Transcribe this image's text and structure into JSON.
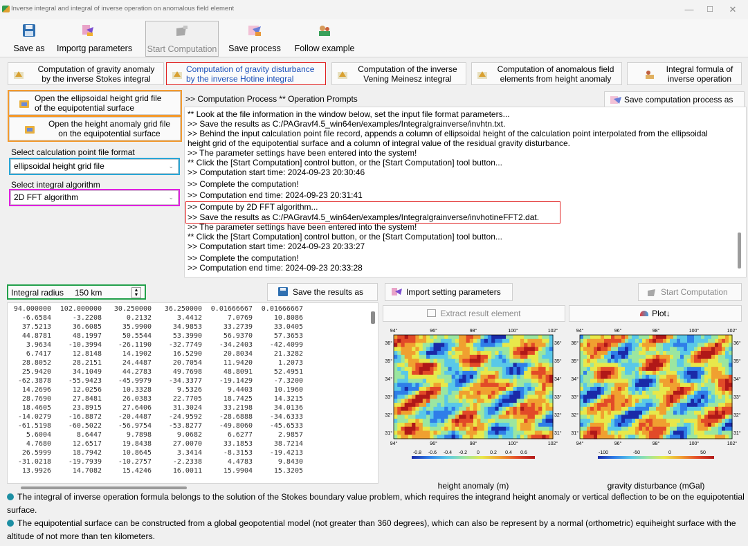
{
  "window": {
    "title": "Inverse integral and integral of inverse operation on anomalous field element"
  },
  "toolbar": {
    "save_as": "Save as",
    "import_params": "Importg parameters",
    "start": "Start Computation",
    "save_process": "Save process",
    "follow": "Follow example"
  },
  "functions": {
    "f1_a": "Computation of gravity anomaly",
    "f1_b": "by the inverse Stokes integral",
    "f2_a": "Computation of gravity disturbance",
    "f2_b": "by the inverse Hotine integral",
    "f3_a": "Computation of the inverse",
    "f3_b": "Vening Meinesz integral",
    "f4_a": "Computation of anomalous field",
    "f4_b": "elements from height anomaly",
    "f5_a": "Integral formula of",
    "f5_b": "inverse operation"
  },
  "left": {
    "open_ell_a": "Open the ellipsoidal height grid file",
    "open_ell_b": "of the equipotential surface",
    "open_ha_a": "Open the height anomaly grid file",
    "open_ha_b": "on the equipotential surface",
    "fmt_label": "Select calculation point file format",
    "fmt_value": "ellipsoidal height grid file",
    "alg_label": "Select integral algorithm",
    "alg_value": "2D FFT algorithm",
    "radius_label": "Integral radius",
    "radius_value": "150 km"
  },
  "log": {
    "header": ">> Computation Process  ** Operation Prompts",
    "save_btn": "Save computation process as",
    "lines": [
      "  ** Look at the file information in the window below, set the input file format parameters...",
      ">> Save the results as C:/PAGravf4.5_win64en/examples/Integralgrainverse/invhtn.txt.",
      ">> Behind the input calculation point file record, appends a column of ellipsoidal height of the calculation point interpolated from the ellipsoidal",
      "height grid of the equipotential surface and a column of integral value of the residual gravity disturbance.",
      ">> The parameter settings have been entered into the system!",
      "  ** Click the [Start Computation] control button, or the [Start Computation] tool button...",
      ">> Computation start time:  2024-09-23 20:30:46",
      ">> Complete the computation!",
      ">> Computation end time: 2024-09-23 20:31:41",
      ">> Compute by 2D FFT algorithm...",
      ">> Save the results as C:/PAGravf4.5_win64en/examples/Integralgrainverse/invhotineFFT2.dat.",
      ">> The parameter settings have been entered into the system!",
      "  ** Click the [Start Computation] control button, or the [Start Computation] tool button...",
      ">> Computation start time:  2024-09-23 20:33:27",
      ">> Complete the computation!",
      ">> Computation end time: 2024-09-23 20:33:28"
    ]
  },
  "actions": {
    "save_results": "Save the results as",
    "import_settings": "Import setting parameters",
    "start2": "Start Computation"
  },
  "grid": {
    "rows": [
      [
        "94.000000",
        "102.000000",
        "30.250000",
        "36.250000",
        "0.01666667",
        "0.01666667"
      ],
      [
        "-6.6584",
        "-3.2208",
        "0.2132",
        "3.4412",
        "7.0769",
        "10.8086"
      ],
      [
        "37.5213",
        "36.6085",
        "35.9900",
        "34.9853",
        "33.2739",
        "33.0405"
      ],
      [
        "44.8781",
        "48.1997",
        "50.5544",
        "53.3990",
        "56.9370",
        "57.3653"
      ],
      [
        "3.9634",
        "-10.3994",
        "-26.1190",
        "-32.7749",
        "-34.2403",
        "-42.4099"
      ],
      [
        "6.7417",
        "12.8148",
        "14.1902",
        "16.5290",
        "20.8034",
        "21.3282"
      ],
      [
        "28.8052",
        "28.2151",
        "24.4487",
        "20.7054",
        "11.9420",
        "1.2073"
      ],
      [
        "25.9420",
        "34.1049",
        "44.2783",
        "49.7698",
        "48.8091",
        "52.4951"
      ],
      [
        "-62.3878",
        "-55.9423",
        "-45.9979",
        "-34.3377",
        "-19.1429",
        "-7.3200"
      ],
      [
        "14.2696",
        "12.0256",
        "10.3328",
        "9.5326",
        "9.4403",
        "10.1960"
      ],
      [
        "28.7690",
        "27.8481",
        "26.0383",
        "22.7705",
        "18.7425",
        "14.3215"
      ],
      [
        "18.4605",
        "23.8915",
        "27.6406",
        "31.3024",
        "33.2198",
        "34.0136"
      ],
      [
        "-14.0279",
        "-16.8872",
        "-20.4487",
        "-24.9592",
        "-28.6888",
        "-34.6333"
      ],
      [
        "-61.5198",
        "-60.5022",
        "-56.9754",
        "-53.8277",
        "-49.8060",
        "-45.6533"
      ],
      [
        "5.6004",
        "8.6447",
        "9.7898",
        "9.0682",
        "6.6277",
        "2.9857"
      ],
      [
        "4.7680",
        "12.6517",
        "19.8438",
        "27.0070",
        "33.1853",
        "38.7214"
      ],
      [
        "26.5999",
        "18.7942",
        "10.8645",
        "3.3414",
        "-8.3153",
        "-19.4213"
      ],
      [
        "-31.0218",
        "-19.7939",
        "-10.2757",
        "-2.2338",
        "4.4783",
        "9.8430"
      ],
      [
        "13.9926",
        "14.7082",
        "15.4246",
        "16.0011",
        "15.9904",
        "15.3205"
      ]
    ]
  },
  "results": {
    "extract": "Extract result element",
    "plot": "Plot↓",
    "map1": {
      "xticks": [
        "94°",
        "96°",
        "98°",
        "100°",
        "102°"
      ],
      "yticks": [
        "36°",
        "35°",
        "34°",
        "33°",
        "32°",
        "31°"
      ],
      "cbar": [
        "-0.8",
        "-0.6",
        "-0.4",
        "-0.2",
        "0",
        "0.2",
        "0.4",
        "0.6"
      ],
      "caption": "height anomaly (m)"
    },
    "map2": {
      "xticks": [
        "94°",
        "96°",
        "98°",
        "100°",
        "102°"
      ],
      "yticks": [
        "36°",
        "35°",
        "34°",
        "33°",
        "32°",
        "31°"
      ],
      "cbar": [
        "-100",
        "-50",
        "0",
        "50"
      ],
      "caption": "gravity disturbance (mGal)"
    }
  },
  "notes": {
    "n1": "The integral of inverse operation formula belongs to the solution of the Stokes boundary value problem, which requires the integrand height anomaly or vertical deflection to be on the equipotential surface.",
    "n2": "The equipotential surface can be constructed from a global geopotential model (not greater than 360 degrees), which can also be represent by a normal (orthometric) equiheight surface with the altitude of not more than ten kilometers."
  },
  "colors": {
    "red_box": "#e02020",
    "orange_box": "#f39a2e",
    "cyan_box": "#2aa6d6",
    "magenta_box": "#e020e0",
    "green_box": "#22a04a"
  }
}
